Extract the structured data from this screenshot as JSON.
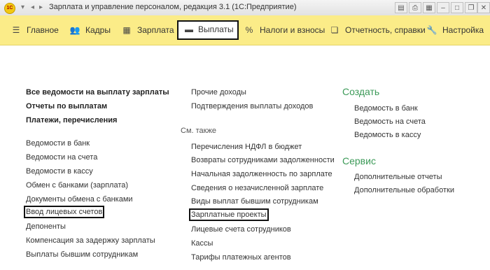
{
  "window": {
    "title": "Зарплата и управление персоналом, редакция 3.1  (1С:Предприятие)",
    "logo_text": "1С"
  },
  "menu": {
    "items": [
      {
        "label": "Главное",
        "icon": "hamburger-icon"
      },
      {
        "label": "Кадры",
        "icon": "people-icon"
      },
      {
        "label": "Зарплата",
        "icon": "calculator-icon"
      },
      {
        "label": "Выплаты",
        "icon": "wallet-icon",
        "active": true
      },
      {
        "label": "Налоги и взносы",
        "icon": "percent-icon"
      },
      {
        "label": "Отчетность, справки",
        "icon": "documents-icon"
      },
      {
        "label": "Настройка",
        "icon": "wrench-icon"
      }
    ]
  },
  "col1": {
    "bold": [
      "Все ведомости на выплату зарплаты",
      "Отчеты по выплатам",
      "Платежи, перечисления"
    ],
    "links": [
      "Ведомости в банк",
      "Ведомости на счета",
      "Ведомости в кассу",
      "Обмен с банками (зарплата)",
      "Документы обмена с банками",
      "Ввод лицевых счетов",
      "Депоненты",
      "Компенсация за задержку зарплаты",
      "Выплаты бывшим сотрудникам"
    ]
  },
  "col2": {
    "links_top": [
      "Прочие доходы",
      "Подтверждения выплаты доходов"
    ],
    "see_also_label": "См. также",
    "links": [
      "Перечисления НДФЛ в бюджет",
      "Возвраты сотрудниками задолженности",
      "Начальная задолженность по зарплате",
      "Сведения о незачисленной зарплате",
      "Виды выплат бывшим сотрудникам",
      "Зарплатные проекты",
      "Лицевые счета сотрудников",
      "Кассы",
      "Тарифы платежных агентов"
    ]
  },
  "col3": {
    "create_title": "Создать",
    "create_links": [
      "Ведомость в банк",
      "Ведомость на счета",
      "Ведомость в кассу"
    ],
    "service_title": "Сервис",
    "service_links": [
      "Дополнительные отчеты",
      "Дополнительные обработки"
    ]
  }
}
